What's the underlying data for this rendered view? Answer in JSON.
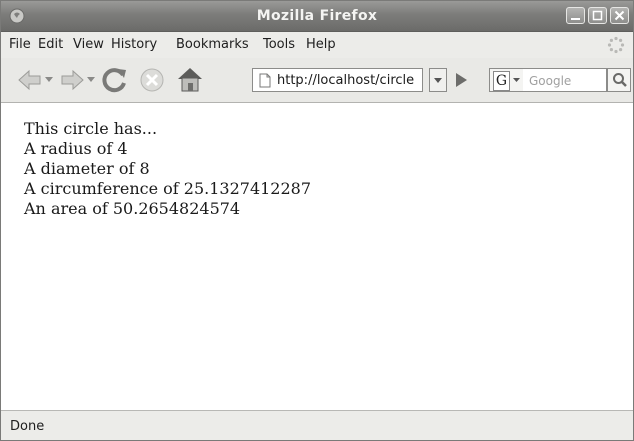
{
  "window": {
    "title": "Mozilla Firefox"
  },
  "menu": {
    "items": [
      "File",
      "Edit",
      "View",
      "History",
      "Bookmarks",
      "Tools",
      "Help"
    ]
  },
  "navigation": {
    "url": "http://localhost/circle",
    "search_placeholder": "Google",
    "search_engine": "G"
  },
  "content": {
    "lines": [
      "This circle has...",
      "A radius of 4",
      "A diameter of 8",
      "A circumference of 25.1327412287",
      "An area of 50.2654824574"
    ]
  },
  "status": {
    "text": "Done"
  }
}
